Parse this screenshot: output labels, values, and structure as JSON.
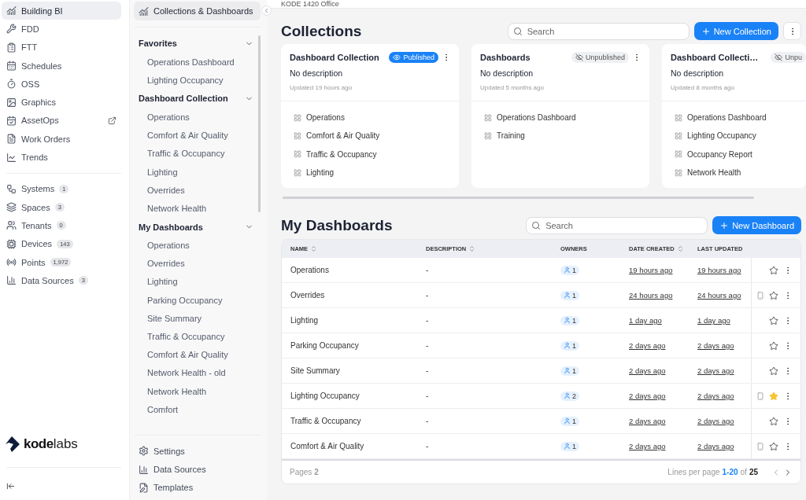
{
  "app_nav": {
    "items": [
      {
        "label": "Building BI",
        "selected": true,
        "external": false
      },
      {
        "label": "FDD",
        "selected": false,
        "external": false
      },
      {
        "label": "FTT",
        "selected": false,
        "external": false
      },
      {
        "label": "Schedules",
        "selected": false,
        "external": false
      },
      {
        "label": "OSS",
        "selected": false,
        "external": false
      },
      {
        "label": "Graphics",
        "selected": false,
        "external": false
      },
      {
        "label": "AssetOps",
        "selected": false,
        "external": true
      },
      {
        "label": "Work Orders",
        "selected": false,
        "external": false
      },
      {
        "label": "Trends",
        "selected": false,
        "external": false
      }
    ],
    "entities": [
      {
        "label": "Systems",
        "count": "1"
      },
      {
        "label": "Spaces",
        "count": "3"
      },
      {
        "label": "Tenants",
        "count": "0"
      },
      {
        "label": "Devices",
        "count": "143"
      },
      {
        "label": "Points",
        "count": "1,972"
      },
      {
        "label": "Data Sources",
        "count": "3"
      }
    ],
    "logo": {
      "bold": "kode",
      "light": "labs"
    }
  },
  "bi_nav": {
    "header": "Collections & Dashboards",
    "sections": [
      {
        "title": "Favorites",
        "expanded": true,
        "items": [
          "Operations Dashboard",
          "Lighting Occupancy"
        ]
      },
      {
        "title": "Dashboard Collection",
        "expanded": true,
        "items": [
          "Operations",
          "Comfort & Air Quality",
          "Traffic & Occupancy",
          "Lighting",
          "Overrides",
          "Network Health"
        ]
      },
      {
        "title": "My Dashboards",
        "expanded": true,
        "items": [
          "Operations",
          "Overrides",
          "Lighting",
          "Parking Occupancy",
          "Site Summary",
          "Traffic & Occupancy",
          "Comfort & Air Quality",
          "Network Health - old",
          "Network Health",
          "Comfort"
        ]
      }
    ],
    "footer": [
      "Settings",
      "Data Sources",
      "Templates"
    ]
  },
  "breadcrumb": "KODE 1420 Office",
  "collections": {
    "title": "Collections",
    "search_placeholder": "Search",
    "new_button": "New Collection",
    "cards": [
      {
        "title": "Dashboard Collection",
        "status": "Published",
        "published": true,
        "description": "No description",
        "updated": "Updated 19 hours ago",
        "items": [
          "Operations",
          "Comfort & Air Quality",
          "Traffic & Occupancy",
          "Lighting"
        ]
      },
      {
        "title": "Dashboards",
        "status": "Unpublished",
        "published": false,
        "description": "No description",
        "updated": "Updated 5 months ago",
        "items": [
          "Operations Dashboard",
          "Training"
        ]
      },
      {
        "title": "Dashboard Collecti…",
        "status": "Unpu",
        "published": false,
        "description": "No description",
        "updated": "Updated 8 months ago",
        "items": [
          "Operations Dashboard",
          "Lighting Occupancy",
          "Occupancy Report",
          "Network Health"
        ]
      }
    ]
  },
  "dashboards": {
    "title": "My Dashboards",
    "search_placeholder": "Search",
    "new_button": "New Dashboard",
    "columns": [
      {
        "label": "NAME",
        "sortable": true
      },
      {
        "label": "DESCRIPTION",
        "sortable": true
      },
      {
        "label": "OWNERS",
        "sortable": false
      },
      {
        "label": "DATE CREATED",
        "sortable": true
      },
      {
        "label": "LAST UPDATED",
        "sortable": false
      }
    ],
    "rows": [
      {
        "name": "Operations",
        "description": "-",
        "owners": "1",
        "created": "19 hours ago",
        "updated": "19 hours ago",
        "mobile": false,
        "starred": false
      },
      {
        "name": "Overrides",
        "description": "-",
        "owners": "1",
        "created": "24 hours ago",
        "updated": "24 hours ago",
        "mobile": true,
        "starred": false
      },
      {
        "name": "Lighting",
        "description": "-",
        "owners": "1",
        "created": "1 day ago",
        "updated": "1 day ago",
        "mobile": false,
        "starred": false
      },
      {
        "name": "Parking Occupancy",
        "description": "-",
        "owners": "1",
        "created": "2 days ago",
        "updated": "2 days ago",
        "mobile": false,
        "starred": false
      },
      {
        "name": "Site Summary",
        "description": "-",
        "owners": "1",
        "created": "2 days ago",
        "updated": "2 days ago",
        "mobile": false,
        "starred": false
      },
      {
        "name": "Lighting Occupancy",
        "description": "-",
        "owners": "2",
        "created": "2 days ago",
        "updated": "2 days ago",
        "mobile": true,
        "starred": true
      },
      {
        "name": "Traffic & Occupancy",
        "description": "-",
        "owners": "1",
        "created": "2 days ago",
        "updated": "2 days ago",
        "mobile": false,
        "starred": false
      },
      {
        "name": "Comfort & Air Quality",
        "description": "-",
        "owners": "1",
        "created": "2 days ago",
        "updated": "2 days ago",
        "mobile": true,
        "starred": false
      }
    ],
    "pagination": {
      "pages": "Pages **2**",
      "lines_label": "Lines per page",
      "range": "1-20",
      "of": "of",
      "total": "25"
    }
  }
}
